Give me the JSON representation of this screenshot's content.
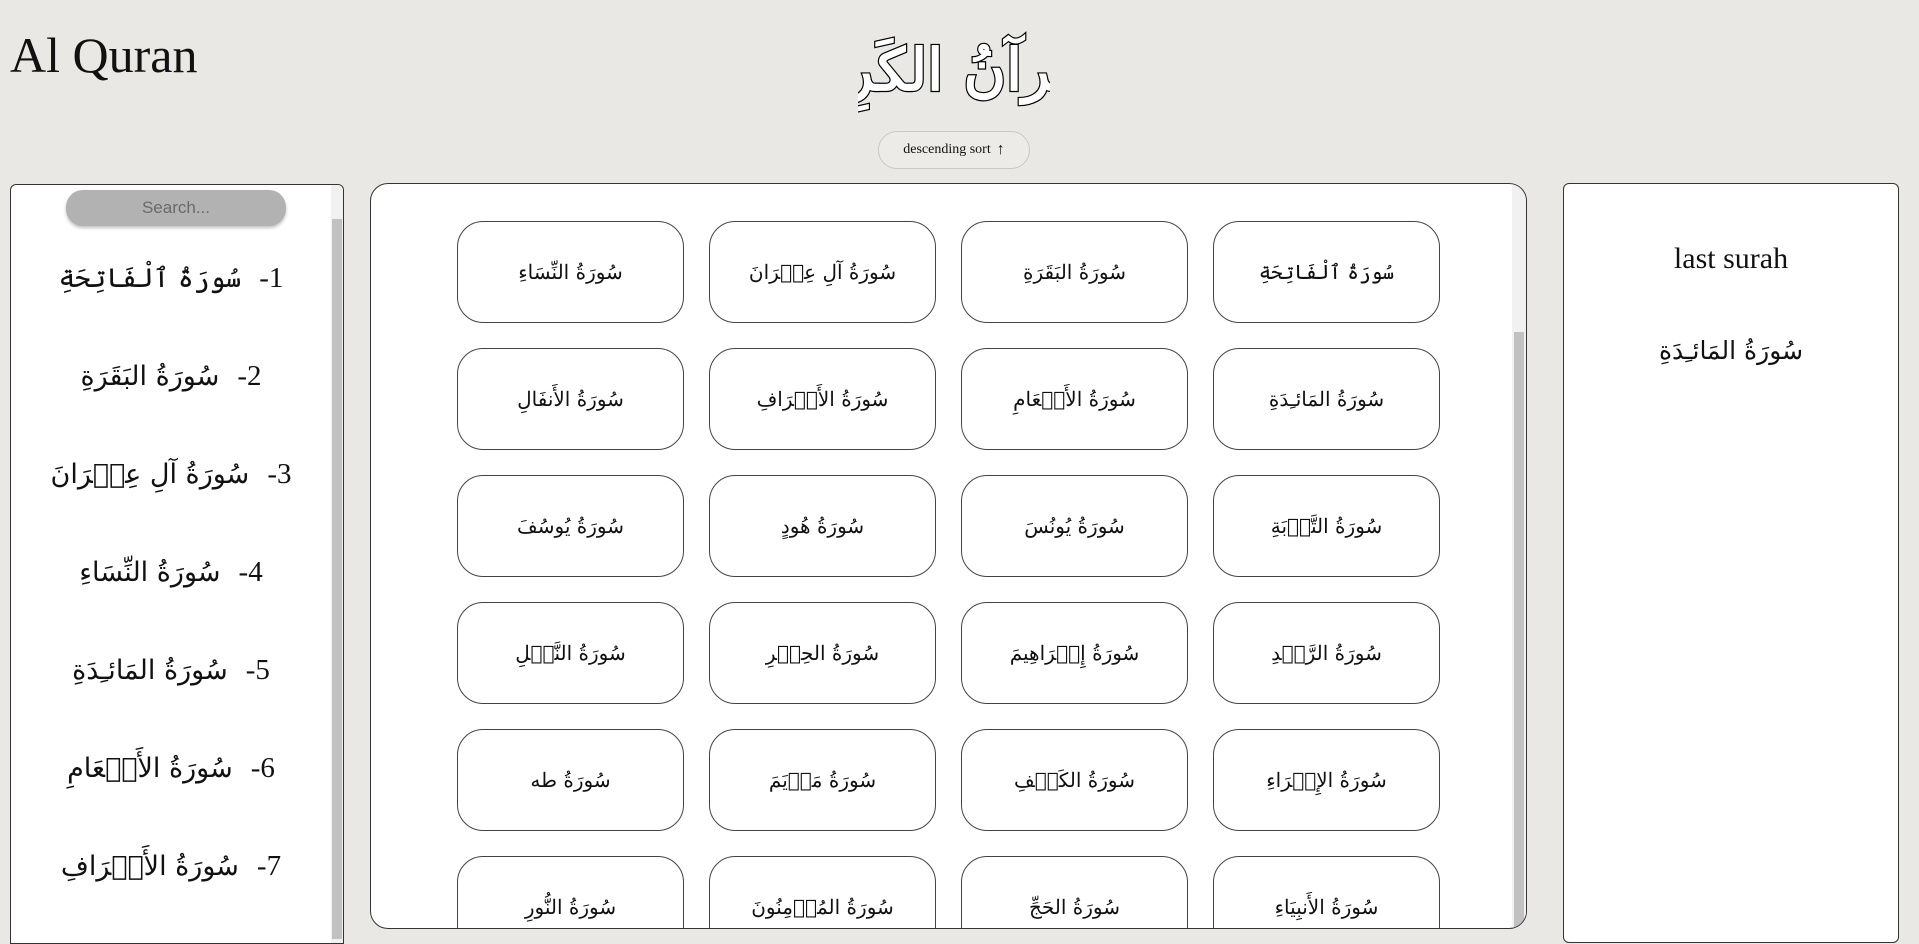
{
  "header": {
    "app_title": "Al Quran",
    "logo_text": "القُرآنُ الكَرِيم",
    "sort_button_label": "descending sort",
    "sort_arrow": "↑"
  },
  "sidebar": {
    "search_placeholder": "Search...",
    "items": [
      {
        "number": "1-",
        "name": "سُورَةُ ٱلْفَاتِحَةِ"
      },
      {
        "number": "2-",
        "name": "سُورَةُ البَقَرَةِ"
      },
      {
        "number": "3-",
        "name": "سُورَةُ آلِ عِمۡرَانَ"
      },
      {
        "number": "4-",
        "name": "سُورَةُ النِّسَاءِ"
      },
      {
        "number": "5-",
        "name": "سُورَةُ المَائـِدَةِ"
      },
      {
        "number": "6-",
        "name": "سُورَةُ الأَنۡعَامِ"
      },
      {
        "number": "7-",
        "name": "سُورَةُ الأَعۡرَافِ"
      }
    ]
  },
  "grid": {
    "surahs": [
      "سُورَةُ ٱلْفَاتِحَةِ",
      "سُورَةُ البَقَرَةِ",
      "سُورَةُ آلِ عِمۡرَانَ",
      "سُورَةُ النِّسَاءِ",
      "سُورَةُ المَائـِدَةِ",
      "سُورَةُ الأَنۡعَامِ",
      "سُورَةُ الأَعۡرَافِ",
      "سُورَةُ الأَنفَالِ",
      "سُورَةُ التَّوۡبَةِ",
      "سُورَةُ يُونُسَ",
      "سُورَةُ هُودٍ",
      "سُورَةُ يُوسُفَ",
      "سُورَةُ الرَّعۡدِ",
      "سُورَةُ إِبۡرَاهِيمَ",
      "سُورَةُ الحِجۡرِ",
      "سُورَةُ النَّحۡلِ",
      "سُورَةُ الإِسۡرَاءِ",
      "سُورَةُ الكَهۡفِ",
      "سُورَةُ مَرۡيَمَ",
      "سُورَةُ طه",
      "سُورَةُ الأَنبِيَاءِ",
      "سُورَةُ الحَجِّ",
      "سُورَةُ المُؤۡمِنُونَ",
      "سُورَةُ النُّورِ"
    ]
  },
  "last_surah": {
    "label": "last surah",
    "name": "سُورَةُ المَائـِدَةِ"
  }
}
